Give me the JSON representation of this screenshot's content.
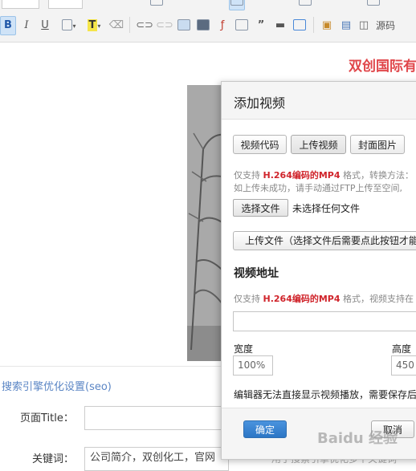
{
  "toolbar": {
    "source_label": "源码",
    "text_color_label": "T"
  },
  "page": {
    "brand": "双创国际有",
    "seo_title": "搜索引擎优化设置(seo)",
    "page_title_label": "页面Title：",
    "page_title_value": "",
    "keywords_label": "关键词：",
    "keywords_value": "公司简介，双创化工，官网",
    "keywords_hint": "用于搜索引擎优化多个关键词"
  },
  "dialog": {
    "title": "添加视频",
    "tabs": [
      {
        "label": "视频代码"
      },
      {
        "label": "上传视频"
      },
      {
        "label": "封面图片"
      }
    ],
    "note1_prefix": "仅支持 ",
    "note1_highlight": "H.264编码的MP4",
    "note1_suffix": " 格式，转换方法：",
    "note2": "如上传未成功，请手动通过FTP上传至空间,",
    "choose_file_label": "选择文件",
    "no_file_text": "未选择任何文件",
    "upload_button_label": "上传文件（选择文件后需要点此按钮才能",
    "video_address_heading": "视频地址",
    "note3_prefix": "仅支持 ",
    "note3_highlight": "H.264编码的MP4",
    "note3_suffix": " 格式，视频支持在",
    "url_value": "",
    "width_label": "宽度",
    "width_value": "100%",
    "height_label": "高度",
    "height_value": "450",
    "warning": "编辑器无法直接显示视频播放，需要保存后",
    "ok_label": "确定",
    "cancel_label": "取消"
  },
  "watermark": "Baidu 经验"
}
